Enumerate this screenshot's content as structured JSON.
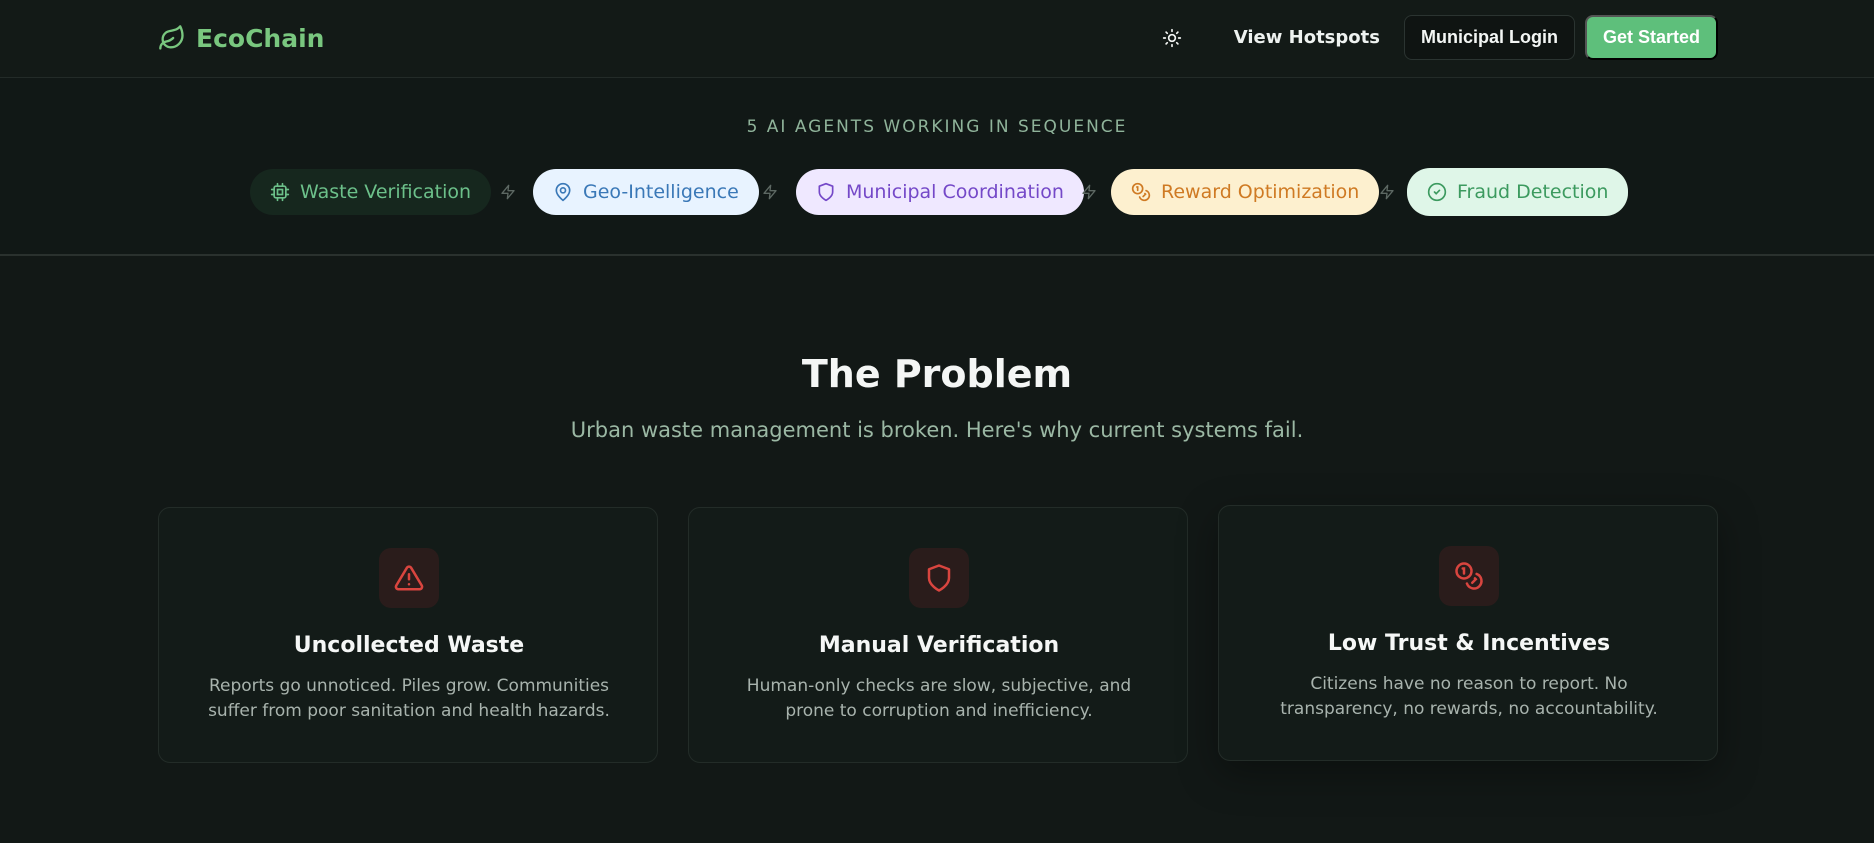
{
  "header": {
    "brand": "EcoChain",
    "nav": {
      "view_hotspots": "View Hotspots",
      "municipal_login": "Municipal Login",
      "get_started": "Get Started"
    }
  },
  "agents": {
    "heading": "5 AI AGENTS WORKING IN SEQUENCE",
    "items": [
      {
        "label": "Waste Verification",
        "icon": "cpu-icon"
      },
      {
        "label": "Geo-Intelligence",
        "icon": "map-pin-icon"
      },
      {
        "label": "Municipal Coordination",
        "icon": "shield-icon"
      },
      {
        "label": "Reward Optimization",
        "icon": "coins-icon"
      },
      {
        "label": "Fraud Detection",
        "icon": "check-circle-icon"
      }
    ]
  },
  "problem": {
    "title": "The Problem",
    "subtitle": "Urban waste management is broken. Here's why current systems fail.",
    "cards": [
      {
        "icon": "alert-triangle-icon",
        "title": "Uncollected Waste",
        "description": "Reports go unnoticed. Piles grow. Communities suffer from poor sanitation and health hazards."
      },
      {
        "icon": "shield-icon",
        "title": "Manual Verification",
        "description": "Human-only checks are slow, subjective, and prone to corruption and inefficiency."
      },
      {
        "icon": "coins-icon",
        "title": "Low Trust & Incentives",
        "description": "Citizens have no reason to report. No transparency, no rewards, no accountability."
      }
    ]
  },
  "colors": {
    "brand": "#79c77f",
    "primary_button": "#5ebf7b",
    "danger_icon": "#d9453f"
  }
}
